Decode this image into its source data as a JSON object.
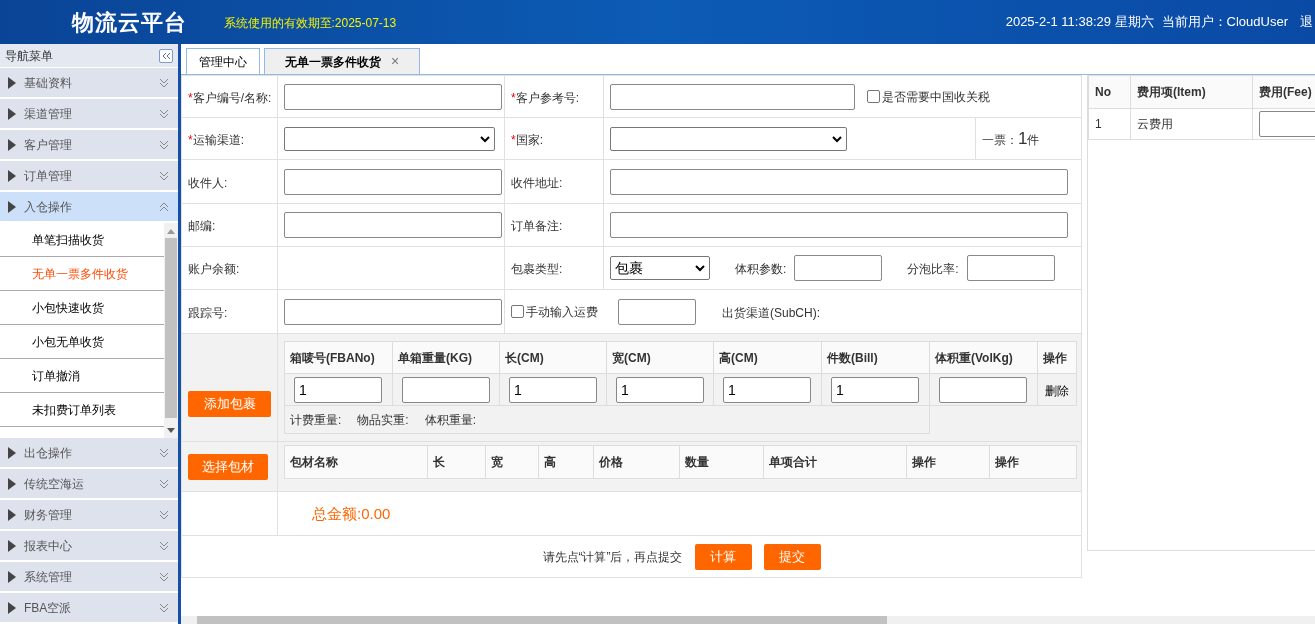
{
  "header": {
    "title": "物流云平台",
    "validity": "系统使用的有效期至:2025-07-13",
    "datetime": "2025-2-1 11:38:29 星期六",
    "user": "当前用户：CloudUser",
    "logout": "退"
  },
  "sidebar": {
    "title": "导航菜单",
    "groups": [
      {
        "label": "基础资料",
        "expanded": false
      },
      {
        "label": "渠道管理",
        "expanded": false
      },
      {
        "label": "客户管理",
        "expanded": false
      },
      {
        "label": "订单管理",
        "expanded": false
      },
      {
        "label": "入仓操作",
        "expanded": true,
        "children": [
          {
            "label": "单笔扫描收货",
            "selected": false
          },
          {
            "label": "无单一票多件收货",
            "selected": true
          },
          {
            "label": "小包快速收货",
            "selected": false
          },
          {
            "label": "小包无单收货",
            "selected": false
          },
          {
            "label": "订单撤消",
            "selected": false
          },
          {
            "label": "未扣费订单列表",
            "selected": false
          }
        ]
      },
      {
        "label": "出仓操作",
        "expanded": false
      },
      {
        "label": "传统空海运",
        "expanded": false
      },
      {
        "label": "财务管理",
        "expanded": false
      },
      {
        "label": "报表中心",
        "expanded": false
      },
      {
        "label": "系统管理",
        "expanded": false
      },
      {
        "label": "FBA空派",
        "expanded": false
      }
    ]
  },
  "tabs": [
    {
      "label": "管理中心",
      "selected": false
    },
    {
      "label": "无单一票多件收货",
      "selected": true,
      "close": "×"
    }
  ],
  "form": {
    "customer": {
      "label": "客户编号/名称:",
      "mark": "*"
    },
    "reference": {
      "label": "客户参考号:",
      "mark": "*"
    },
    "tax": {
      "label": "是否需要中国收关税",
      "checked": false
    },
    "channel": {
      "label": "运输渠道:",
      "mark": "*"
    },
    "country": {
      "label": "国家:",
      "mark": "*"
    },
    "pieces": {
      "prefix": "一票：",
      "count": "1",
      "unit": "件"
    },
    "recipient": {
      "label": "收件人:"
    },
    "address": {
      "label": "收件地址:"
    },
    "postcode": {
      "label": "邮编:"
    },
    "remark": {
      "label": "订单备注:"
    },
    "balance": {
      "label": "账户余额:"
    },
    "package_type": {
      "label": "包裹类型:",
      "value": "包裹"
    },
    "volume_param": {
      "label": "体积参数:"
    },
    "split_rate": {
      "label": "分泡比率:"
    },
    "tracking": {
      "label": "跟踪号:"
    },
    "manual_fee": {
      "label": "手动输入运费",
      "checked": false
    },
    "sub_channel": {
      "label": "出货渠道(SubCH):"
    }
  },
  "packages": {
    "button": "添加包裹",
    "columns": [
      "箱唛号(FBANo)",
      "单箱重量(KG)",
      "长(CM)",
      "宽(CM)",
      "高(CM)",
      "件数(Bill)",
      "体积重(VolKg)",
      "操作"
    ],
    "rows": [
      {
        "cells": [
          {
            "value": "1"
          },
          {},
          {
            "value": "1"
          },
          {
            "value": "1"
          },
          {
            "value": "1"
          },
          {
            "value": "1"
          },
          {}
        ],
        "action": "删除"
      }
    ],
    "summary": [
      "计费重量:",
      "物品实重:",
      "体积重量:"
    ]
  },
  "materials": {
    "button": "选择包材",
    "columns": [
      "包材名称",
      "长",
      "宽",
      "高",
      "价格",
      "数量",
      "单项合计",
      "操作",
      "操作"
    ]
  },
  "total": "总金额:0.00",
  "submit": {
    "hint": "请先点“计算”后，再点提交",
    "buttons": [
      "计算",
      "提交"
    ]
  },
  "fees": {
    "columns": [
      "No",
      "费用项(Item)",
      "费用(Fee)"
    ],
    "rows": [
      {
        "no": "1",
        "item": "云费用"
      }
    ]
  }
}
